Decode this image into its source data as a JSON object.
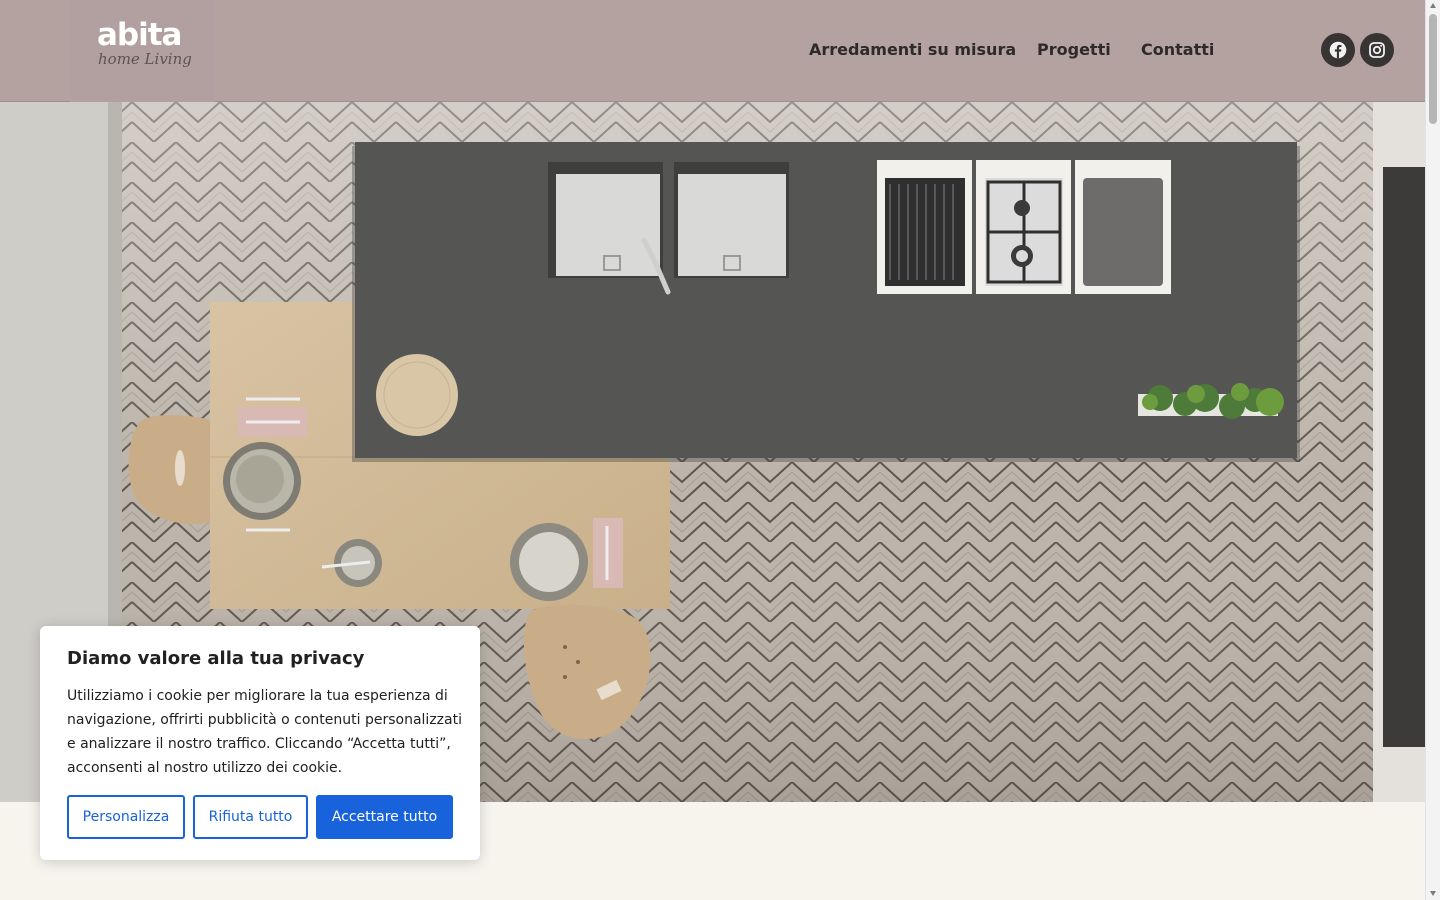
{
  "brand": {
    "logo_main": "abita",
    "logo_sub": "home Living"
  },
  "nav": [
    {
      "label": "Arredamenti su misura"
    },
    {
      "label": "Progetti"
    },
    {
      "label": "Contatti"
    }
  ],
  "social": [
    {
      "icon": "facebook-icon"
    },
    {
      "icon": "instagram-icon"
    }
  ],
  "colors": {
    "header_bg": "#b4a2a1",
    "nav_text": "#2e2a2a",
    "social_bg": "#383434",
    "page_bg": "#f7f4ee",
    "accent": "#1863dc"
  },
  "hero": {
    "image": "top-view kitchen with dark island, double sink, hobs, wooden dining table and chairs on herringbone floor"
  },
  "cookie": {
    "title": "Diamo valore alla tua privacy",
    "text": "Utilizziamo i cookie per migliorare la tua esperienza di navigazione, offrirti pubblicità o contenuti personalizzati e analizzare il nostro traffico. Cliccando “Accetta tutti”, acconsenti al nostro utilizzo dei cookie.",
    "buttons": {
      "customize": "Personalizza",
      "reject": "Rifiuta tutto",
      "accept": "Accettare tutto"
    }
  }
}
